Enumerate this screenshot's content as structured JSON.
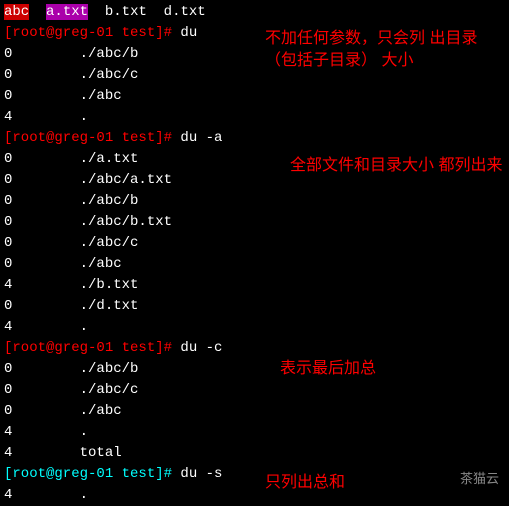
{
  "topbar": {
    "part1": "abc",
    "part2": "a.txt",
    "part3": "b.txt  d.txt"
  },
  "prompts": {
    "p1_user": "[root@greg-01 test]#",
    "p1_cmd": " du",
    "p2_user": "[root@greg-01 test]#",
    "p2_cmd": " du -a",
    "p3_user": "[root@greg-01 test]#",
    "p3_cmd": " du -c",
    "p4_user": "[root@greg-01 test]#",
    "p4_cmd": " du -s"
  },
  "out1": {
    "l1": "0        ./abc/b",
    "l2": "0        ./abc/c",
    "l3": "0        ./abc",
    "l4": "4        ."
  },
  "out2": {
    "l1": "0        ./a.txt",
    "l2": "0        ./abc/a.txt",
    "l3": "0        ./abc/b",
    "l4": "0        ./abc/b.txt",
    "l5": "0        ./abc/c",
    "l6": "0        ./abc",
    "l7": "4        ./b.txt",
    "l8": "0        ./d.txt",
    "l9": "4        ."
  },
  "out3": {
    "l1": "0        ./abc/b",
    "l2": "0        ./abc/c",
    "l3": "0        ./abc",
    "l4": "4        .",
    "l5": "4        total"
  },
  "out4": {
    "l1": "4        ."
  },
  "annotations": {
    "a1": "不加任何参数，只会列\n出目录（包括子目录）\n大小",
    "a2": "全部文件和目录大小\n都列出来",
    "a3": "表示最后加总",
    "a4": "只列出总和"
  },
  "watermark": "茶猫云"
}
